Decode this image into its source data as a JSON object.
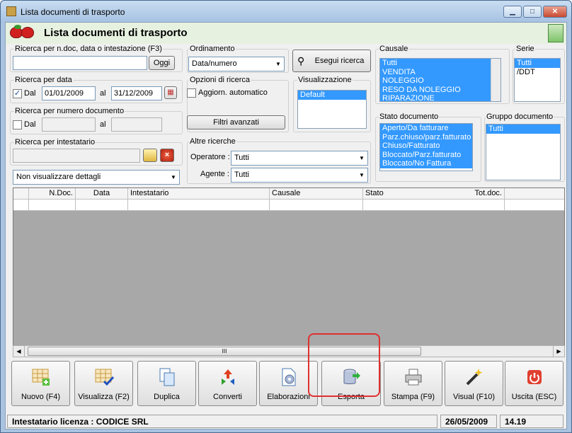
{
  "window": {
    "title": "Lista documenti di trasporto"
  },
  "header": {
    "title": "Lista documenti di trasporto"
  },
  "search_ndoc": {
    "label": "Ricerca per n.doc, data o intestazione (F3)",
    "value": "",
    "oggi_label": "Oggi"
  },
  "search_date": {
    "label": "Ricerca per data",
    "dal_label": "Dal",
    "dal_checked": true,
    "from": "01/01/2009",
    "al_label": "al",
    "to": "31/12/2009"
  },
  "search_number": {
    "label": "Ricerca per numero documento",
    "dal_label": "Dal",
    "dal_checked": false,
    "from": "",
    "al_label": "al",
    "to": ""
  },
  "search_owner": {
    "label": "Ricerca per intestatario",
    "value": ""
  },
  "details_combo": {
    "value": "Non visualizzare dettagli"
  },
  "ordering": {
    "label": "Ordinamento",
    "value": "Data/numero"
  },
  "search_button": {
    "label": "Esegui ricerca"
  },
  "search_options": {
    "label": "Opzioni di ricerca",
    "auto_update_label": "Aggiorn. automatico",
    "auto_update_checked": false,
    "advanced_filters_label": "Filtri avanzati"
  },
  "visualization": {
    "label": "Visualizzazione",
    "items": [
      "Default"
    ],
    "selected": 0
  },
  "other_searches": {
    "label": "Altre ricerche",
    "operator_label": "Operatore :",
    "operator_value": "Tutti",
    "agent_label": "Agente :",
    "agent_value": "Tutti"
  },
  "causale": {
    "label": "Causale",
    "items": [
      "Tutti",
      "VENDITA",
      "NOLEGGIO",
      "RESO DA NOLEGGIO",
      "RIPARAZIONE"
    ]
  },
  "serie": {
    "label": "Serie",
    "items": [
      "Tutti",
      "/DDT"
    ],
    "selected": 0
  },
  "doc_state": {
    "label": "Stato documento",
    "items": [
      "Aperto/Da fatturare",
      "Parz.chiuso/parz.fatturato",
      "Chiuso/Fatturato",
      "Bloccato/Parz.fatturato",
      "Bloccato/No Fattura"
    ]
  },
  "doc_group": {
    "label": "Gruppo documento",
    "items": [
      "Tutti"
    ],
    "selected": 0
  },
  "grid": {
    "columns": [
      "",
      "N.Doc.",
      "Data",
      "Intestatario",
      "Causale",
      "Stato",
      "Tot.doc.",
      ""
    ],
    "scroll_label": "III"
  },
  "toolbar": {
    "buttons": [
      {
        "label": "Nuovo (F4)",
        "icon": "new-grid-icon"
      },
      {
        "label": "Visualizza (F2)",
        "icon": "view-grid-icon"
      },
      {
        "label": "Duplica",
        "icon": "duplicate-icon"
      },
      {
        "label": "Converti",
        "icon": "convert-icon"
      },
      {
        "label": "Elaborazioni",
        "icon": "process-icon"
      },
      {
        "label": "Esporta",
        "icon": "export-database-icon"
      },
      {
        "label": "Stampa (F9)",
        "icon": "printer-icon"
      },
      {
        "label": "Visual (F10)",
        "icon": "magic-wand-icon"
      },
      {
        "label": "Uscita (ESC)",
        "icon": "exit-power-icon"
      }
    ]
  },
  "status": {
    "license": "Intestatario licenza : CODICE SRL",
    "date": "26/05/2009",
    "time": "14.19"
  },
  "colors": {
    "selection": "#3399ff",
    "highlight": "#e03030",
    "grid_bg": "#a8a8a8"
  }
}
